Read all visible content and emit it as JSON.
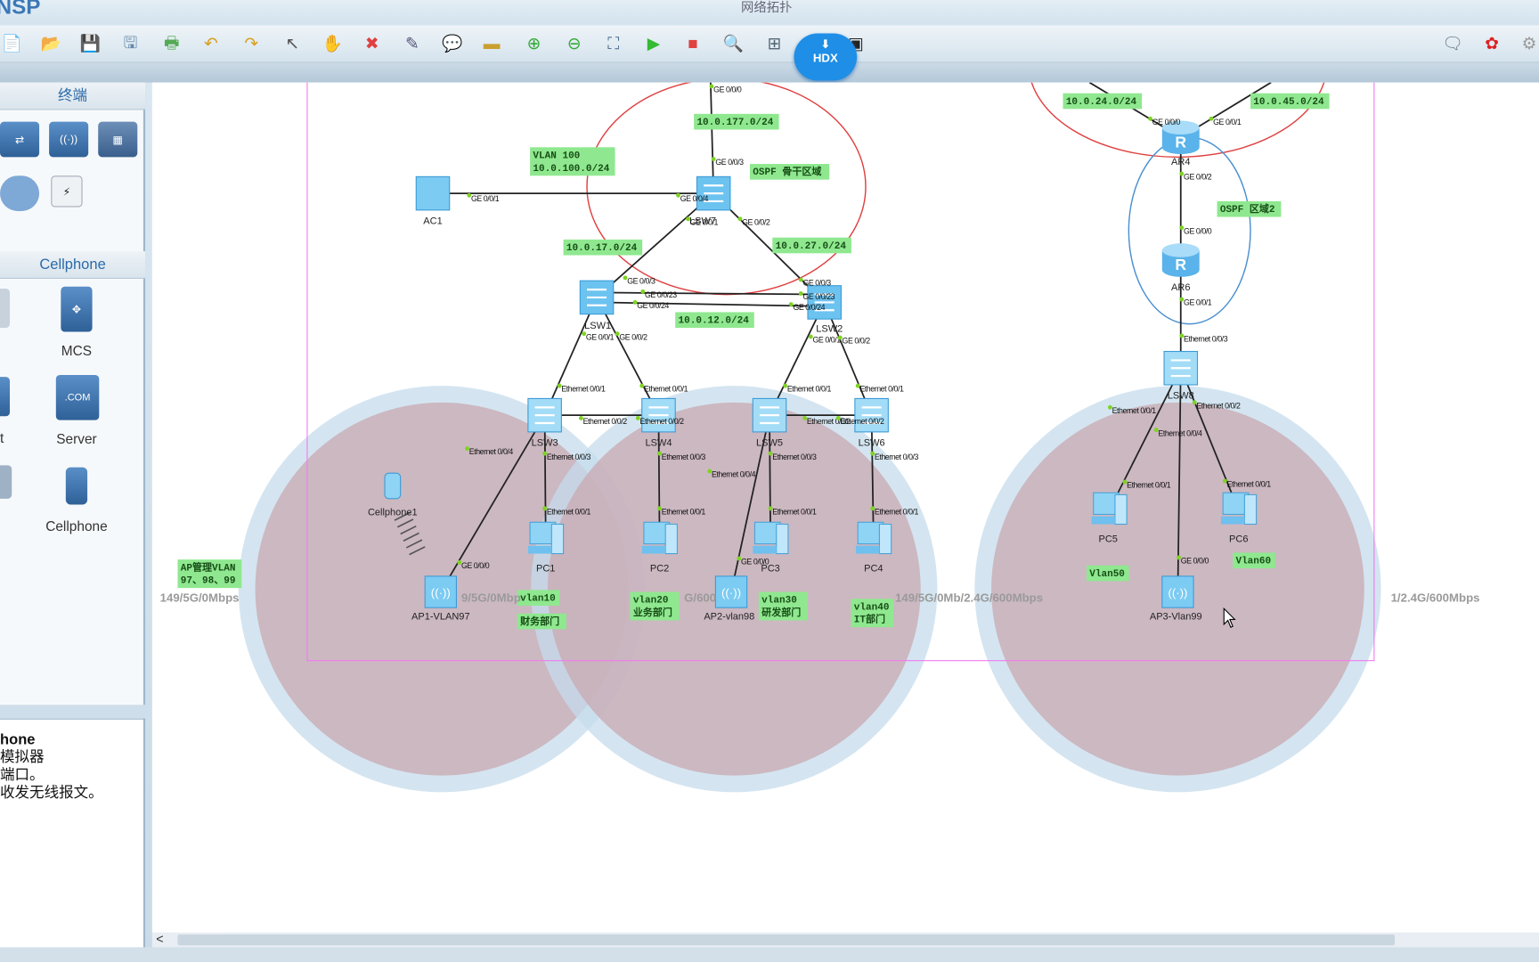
{
  "window": {
    "app_name": "NSP",
    "title": "网络拓扑"
  },
  "toolbar": {
    "buttons": [
      "new-topology",
      "open",
      "save",
      "save-as",
      "print",
      "undo",
      "redo",
      "select",
      "pan",
      "delete",
      "delete-link",
      "text-note",
      "palette",
      "zoom-in",
      "zoom-out",
      "fit",
      "start-device",
      "stop-device",
      "capture",
      "topology",
      "console"
    ],
    "hdx_label": "HDX",
    "right_buttons": [
      "feedback",
      "huawei",
      "settings"
    ]
  },
  "colors": {
    "accent": "#2b6aa8",
    "label_bg": "#8fe88f",
    "ospf_backbone": "#e04040",
    "ospf_area2": "#4a90d0",
    "coverage": "#c5dcec",
    "coverage_inner": "#c9a8b0"
  },
  "left_panel": {
    "section_title": "终端",
    "category_title": "Cellphone",
    "devices": [
      {
        "label": "MCS"
      },
      {
        "label": "Server"
      },
      {
        "label": "Cellphone"
      }
    ],
    "partial_labels": [
      "t"
    ]
  },
  "description": {
    "title": "hone",
    "lines": [
      "模拟器",
      "端口。",
      "收发无线报文。"
    ]
  },
  "topology": {
    "nodes": [
      {
        "name": "LSW7",
        "type": "l3switch"
      },
      {
        "name": "AC1",
        "type": "ac"
      },
      {
        "name": "LSW1",
        "type": "l3switch"
      },
      {
        "name": "LSW2",
        "type": "l3switch"
      },
      {
        "name": "LSW3",
        "type": "switch"
      },
      {
        "name": "LSW4",
        "type": "switch"
      },
      {
        "name": "LSW5",
        "type": "switch"
      },
      {
        "name": "LSW6",
        "type": "switch"
      },
      {
        "name": "PC1",
        "type": "pc"
      },
      {
        "name": "PC2",
        "type": "pc"
      },
      {
        "name": "PC3",
        "type": "pc"
      },
      {
        "name": "PC4",
        "type": "pc"
      },
      {
        "name": "AP1-VLAN97",
        "type": "ap"
      },
      {
        "name": "AP2-vlan98",
        "type": "ap"
      },
      {
        "name": "Cellphone1",
        "type": "phone"
      },
      {
        "name": "AR4",
        "type": "router"
      },
      {
        "name": "AR6",
        "type": "router"
      },
      {
        "name": "LSW8",
        "type": "switch"
      },
      {
        "name": "PC5",
        "type": "pc"
      },
      {
        "name": "PC6",
        "type": "pc"
      },
      {
        "name": "AP3-Vlan99",
        "type": "ap"
      }
    ],
    "ports": [
      "GE 0/0/0",
      "GE 0/0/3",
      "GE 0/0/4",
      "GE 0/0/1",
      "GE 0/0/2",
      "GE 0/0/1",
      "GE 0/0/3",
      "GE 0/0/23",
      "GE 0/0/24",
      "GE 0/0/1",
      "GE 0/0/2",
      "GE 0/0/3",
      "GE 0/0/23",
      "GE 0/0/24",
      "GE 0/0/1",
      "GE 0/0/2",
      "Ethernet 0/0/1",
      "Ethernet 0/0/2",
      "Ethernet 0/0/4",
      "Ethernet 0/0/3",
      "Ethernet 0/0/1",
      "Ethernet 0/0/2",
      "Ethernet 0/0/3",
      "Ethernet 0/0/1",
      "Ethernet 0/0/2",
      "Ethernet 0/0/4",
      "Ethernet 0/0/3",
      "Ethernet 0/0/1",
      "Ethernet 0/0/2",
      "Ethernet 0/0/3",
      "Ethernet 0/0/1",
      "Ethernet 0/0/1",
      "Ethernet 0/0/1",
      "Ethernet 0/0/1",
      "GE 0/0/0",
      "GE 0/0/0",
      "GE 0/0/0",
      "GE 0/0/1",
      "GE 0/0/2",
      "GE 0/0/0",
      "GE 0/0/1",
      "Ethernet 0/0/3",
      "Ethernet 0/0/1",
      "Ethernet 0/0/2",
      "Ethernet 0/0/4",
      "Ethernet 0/0/1",
      "Ethernet 0/0/1",
      "GE 0/0/0"
    ],
    "labels": [
      [
        "10.0.177.0/24"
      ],
      [
        "VLAN 100",
        "10.0.100.0/24"
      ],
      [
        "OSPF 骨干区域"
      ],
      [
        "10.0.17.0/24"
      ],
      [
        "10.0.27.0/24"
      ],
      [
        "10.0.12.0/24"
      ],
      [
        "10.0.24.0/24"
      ],
      [
        "10.0.45.0/24"
      ],
      [
        "OSPF 区域2"
      ],
      [
        "AP管理VLAN",
        "97、98、99"
      ],
      [
        "vlan10"
      ],
      [
        "财务部门"
      ],
      [
        "vlan20",
        "业务部门"
      ],
      [
        "vlan30",
        "研发部门"
      ],
      [
        "vlan40",
        "IT部门"
      ],
      [
        "Vlan50"
      ],
      [
        "Vlan60"
      ]
    ],
    "rates": [
      "149/5G/0Mbps",
      "9/5G/0Mbp",
      "G/600",
      "149/5G/0Mb/2.4G/600Mbps",
      "1/2.4G/600Mbps"
    ]
  }
}
